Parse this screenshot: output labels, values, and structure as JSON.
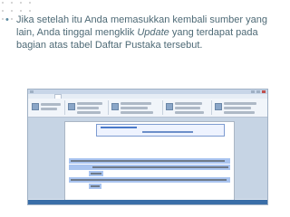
{
  "slide": {
    "bullet_symbol": "•",
    "text_before": "Jika setelah itu Anda memasukkan kembali sumber yang lain, Anda tinggal mengklik ",
    "text_emph": "Update",
    "text_after": " yang terdapat pada bagian atas tabel Daftar Pustaka tersebut."
  }
}
